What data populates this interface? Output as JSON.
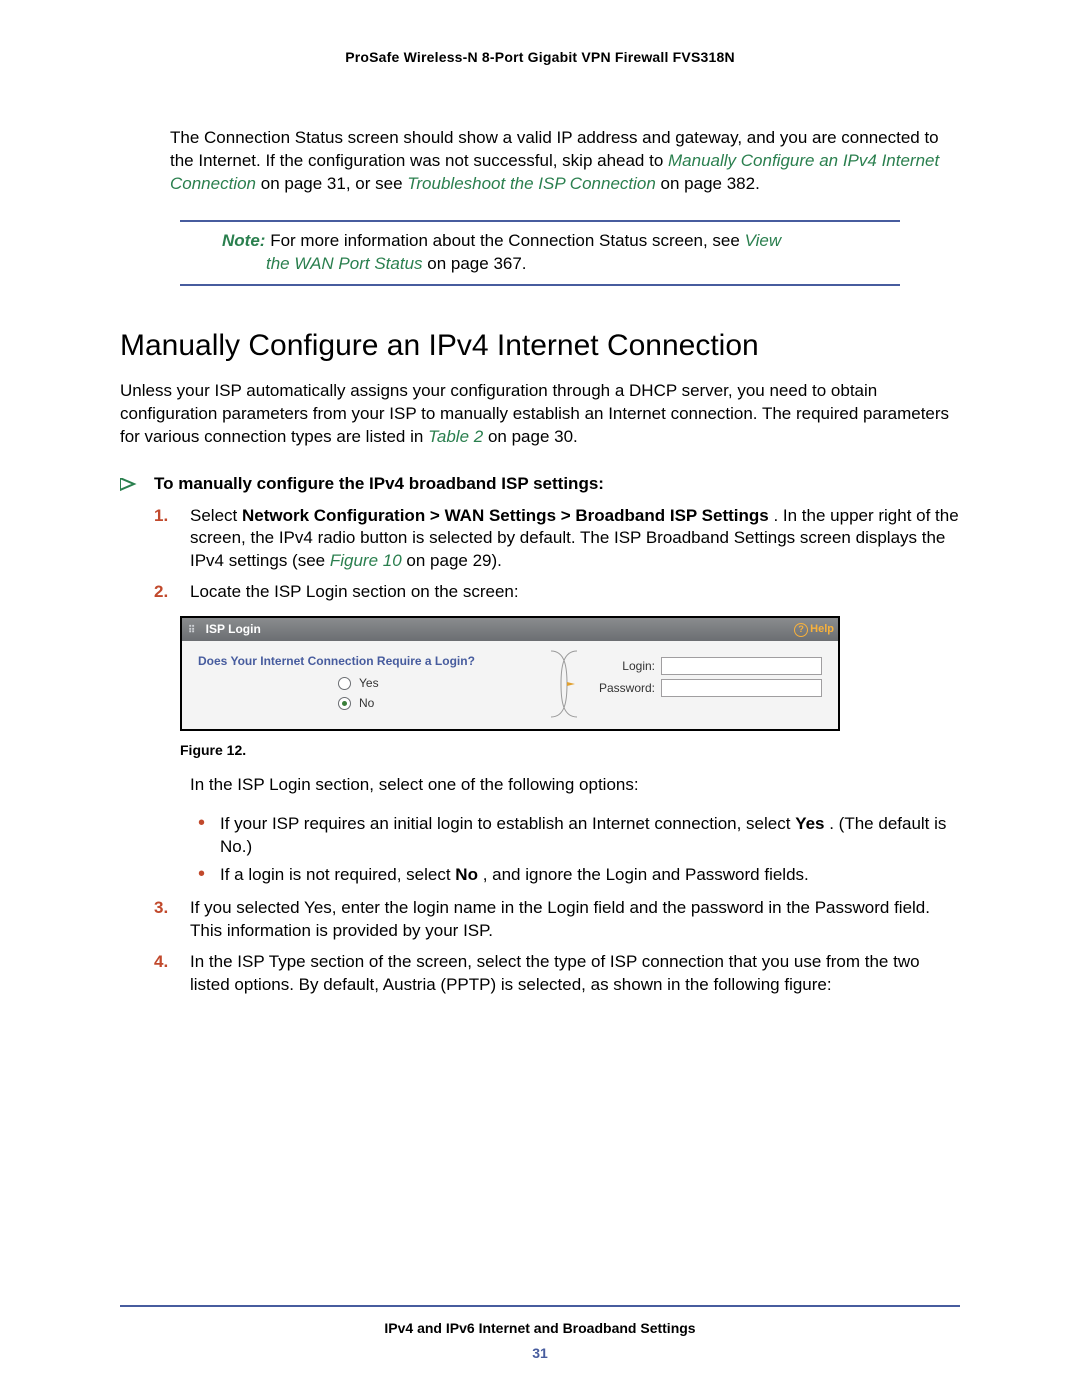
{
  "header": {
    "title": "ProSafe Wireless-N 8-Port Gigabit VPN Firewall FVS318N"
  },
  "intro": {
    "pre": "The Connection Status screen should show a valid IP address and gateway, and you are connected to the Internet. If the configuration was not successful, skip ahead to ",
    "link1": "Manually Configure an IPv4 Internet Connection",
    "mid1": " on page 31, or see ",
    "link2": "Troubleshoot the ISP Connection",
    "tail": " on page 382."
  },
  "note": {
    "label": "Note:",
    "line1": "  For more information about the Connection Status screen, see ",
    "link": "View the WAN Port Status",
    "tail": " on page 367."
  },
  "heading": "Manually Configure an IPv4 Internet Connection",
  "section_intro": {
    "pre": "Unless your ISP automatically assigns your configuration through a DHCP server, you need to obtain configuration parameters from your ISP to manually establish an Internet connection. The required parameters for various connection types are listed in ",
    "link": "Table 2",
    "tail": " on page 30."
  },
  "task_title": "To manually configure the IPv4 broadband ISP settings:",
  "steps": {
    "s1": {
      "num": "1.",
      "a": "Select ",
      "b": "Network Configuration > WAN Settings > Broadband ISP Settings",
      "c": ". In the upper right of the screen, the IPv4 radio button is selected by default. The ISP Broadband Settings screen displays the IPv4 settings (see ",
      "link": "Figure 10",
      "d": " on page 29)."
    },
    "s2": {
      "num": "2.",
      "text": "Locate the ISP Login section on the screen:"
    },
    "s3": {
      "num": "3.",
      "text": "If you selected Yes, enter the login name in the Login field and the password in the Password field. This information is provided by your ISP."
    },
    "s4": {
      "num": "4.",
      "text": "In the ISP Type section of the screen, select the type of ISP connection that you use from the two listed options. By default, Austria (PPTP) is selected, as shown in the following figure:"
    }
  },
  "figure": {
    "panel_title": "ISP Login",
    "help_label": "Help",
    "question": "Does Your Internet Connection Require a Login?",
    "opt_yes": "Yes",
    "opt_no": "No",
    "login_label": "Login:",
    "password_label": "Password:",
    "login_value": "",
    "password_value": "",
    "caption": "Figure 12."
  },
  "post_fig_intro": "In the ISP Login section, select one of the following options:",
  "post_fig_bullets": {
    "b1a": "If your ISP requires an initial login to establish an Internet connection, select ",
    "b1b": "Yes",
    "b1c": ". (The default is No.)",
    "b2a": "If a login is not required, select ",
    "b2b": "No",
    "b2c": ", and ignore the Login and Password fields."
  },
  "footer": {
    "chapter": "IPv4 and IPv6 Internet and Broadband Settings",
    "page": "31"
  }
}
